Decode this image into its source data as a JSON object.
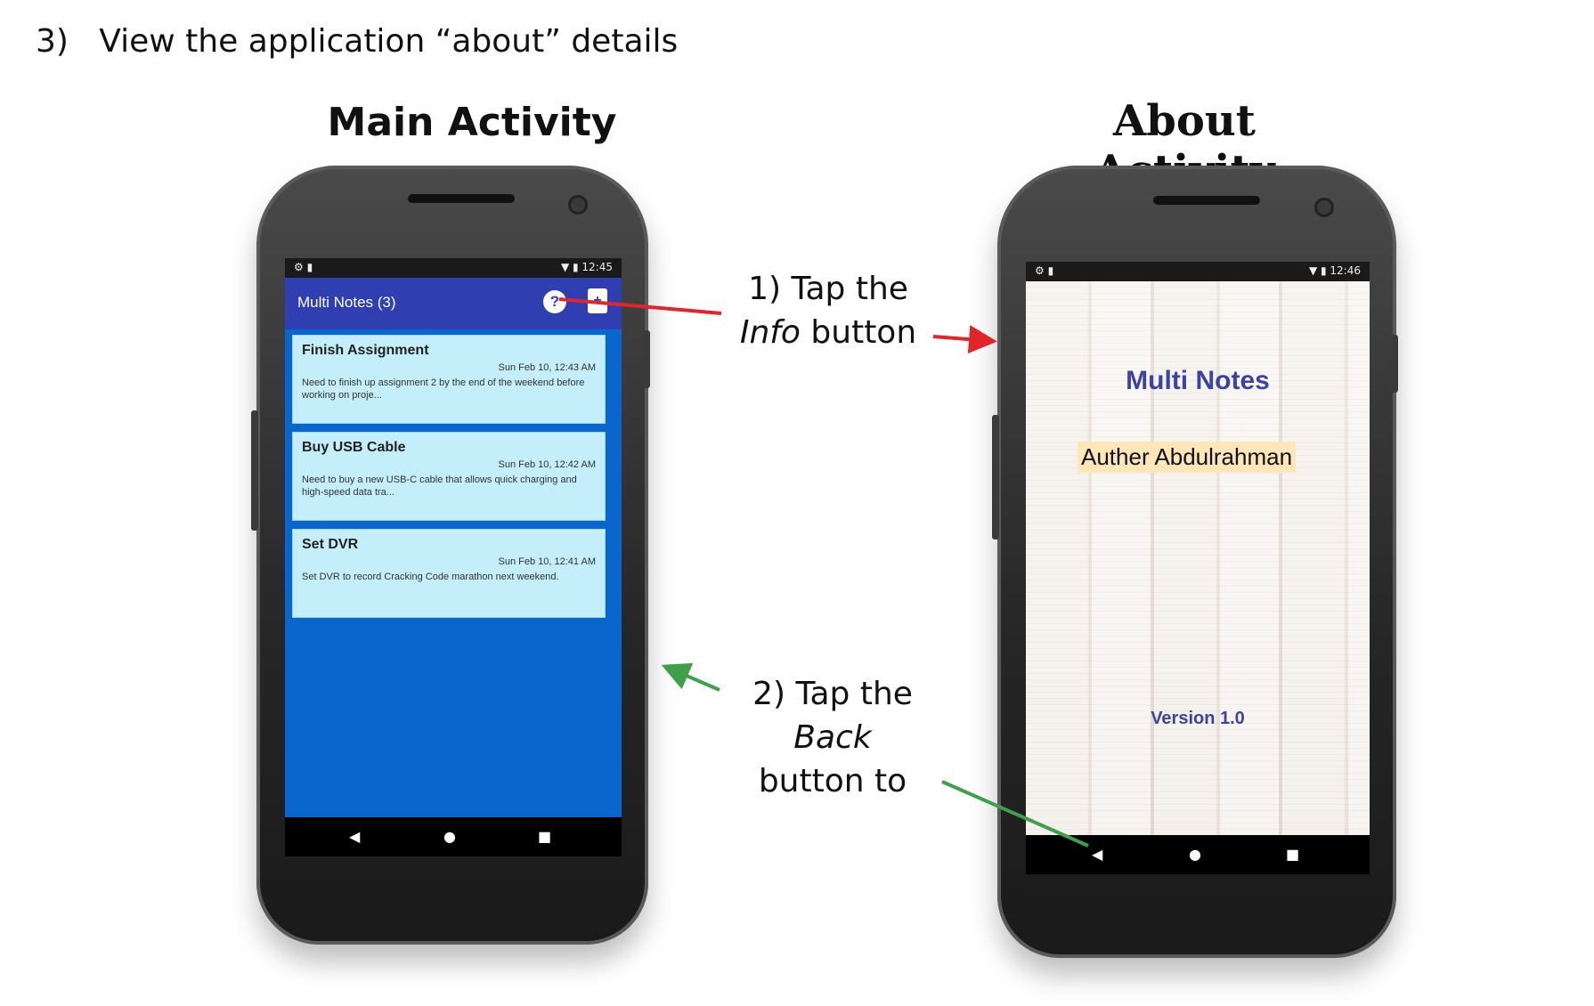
{
  "heading": {
    "number": "3)",
    "text": "View the application “about” details"
  },
  "titles": {
    "main": "Main Activity",
    "about": "About Activity"
  },
  "callouts": {
    "info": {
      "line1": "1) Tap the",
      "emph": "Info",
      "rest": " button"
    },
    "back": {
      "line1": "2) Tap the",
      "emph": "Back",
      "line3": "button to"
    }
  },
  "arrow_colors": {
    "info": "#e0262b",
    "back": "#3ea04a"
  },
  "main_screen": {
    "status_time": "12:45",
    "app_title": "Multi Notes (3)",
    "info_icon": "info-icon",
    "add_icon": "add-note-icon",
    "colors": {
      "appbar": "#2f3fb2",
      "background": "#0a66cc",
      "note": "#c4eefa"
    },
    "notes": [
      {
        "title": "Finish Assignment",
        "date": "Sun Feb 10, 12:43 AM",
        "body": "Need to finish up assignment 2 by the end of the weekend before working on proje..."
      },
      {
        "title": "Buy USB Cable",
        "date": "Sun Feb 10, 12:42 AM",
        "body": "Need to buy a new USB-C cable that allows quick charging and high-speed data tra..."
      },
      {
        "title": "Set DVR",
        "date": "Sun Feb 10, 12:41 AM",
        "body": "Set DVR to record Cracking Code marathon next weekend."
      }
    ],
    "nav": {
      "back": "◀",
      "home": "●",
      "recents": "■"
    }
  },
  "about_screen": {
    "status_time": "12:46",
    "app_name": "Multi Notes",
    "author": "Auther Abdulrahman",
    "version": "Version 1.0",
    "nav": {
      "back": "◀",
      "home": "●",
      "recents": "■"
    }
  }
}
